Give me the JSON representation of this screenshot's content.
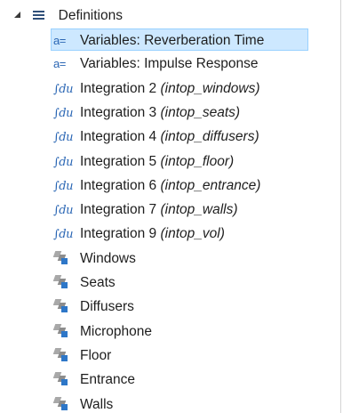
{
  "tree": {
    "root": {
      "label": "Definitions",
      "icon": "definitions-icon"
    },
    "items": [
      {
        "type": "variables",
        "icon": "variables-icon",
        "icon_text": "a=",
        "label": "Variables: Reverberation Time",
        "tag": "",
        "selected": true
      },
      {
        "type": "variables",
        "icon": "variables-icon",
        "icon_text": "a=",
        "label": "Variables: Impulse Response",
        "tag": "",
        "selected": false
      },
      {
        "type": "integration",
        "icon": "integration-icon",
        "icon_text": "∫du",
        "label": "Integration 2 ",
        "tag": "(intop_windows)",
        "selected": false
      },
      {
        "type": "integration",
        "icon": "integration-icon",
        "icon_text": "∫du",
        "label": "Integration 3 ",
        "tag": "(intop_seats)",
        "selected": false
      },
      {
        "type": "integration",
        "icon": "integration-icon",
        "icon_text": "∫du",
        "label": "Integration 4 ",
        "tag": "(intop_diffusers)",
        "selected": false
      },
      {
        "type": "integration",
        "icon": "integration-icon",
        "icon_text": "∫du",
        "label": "Integration 5 ",
        "tag": "(intop_floor)",
        "selected": false
      },
      {
        "type": "integration",
        "icon": "integration-icon",
        "icon_text": "∫du",
        "label": "Integration 6 ",
        "tag": "(intop_entrance)",
        "selected": false
      },
      {
        "type": "integration",
        "icon": "integration-icon",
        "icon_text": "∫du",
        "label": "Integration 7 ",
        "tag": "(intop_walls)",
        "selected": false
      },
      {
        "type": "integration",
        "icon": "integration-icon",
        "icon_text": "∫du",
        "label": "Integration 9 ",
        "tag": "(intop_vol)",
        "selected": false
      },
      {
        "type": "selection",
        "icon": "selection-icon",
        "icon_text": "",
        "label": "Windows",
        "tag": "",
        "selected": false
      },
      {
        "type": "selection",
        "icon": "selection-icon",
        "icon_text": "",
        "label": "Seats",
        "tag": "",
        "selected": false
      },
      {
        "type": "selection",
        "icon": "selection-icon",
        "icon_text": "",
        "label": "Diffusers",
        "tag": "",
        "selected": false
      },
      {
        "type": "selection",
        "icon": "selection-icon",
        "icon_text": "",
        "label": "Microphone",
        "tag": "",
        "selected": false
      },
      {
        "type": "selection",
        "icon": "selection-icon",
        "icon_text": "",
        "label": "Floor",
        "tag": "",
        "selected": false
      },
      {
        "type": "selection",
        "icon": "selection-icon",
        "icon_text": "",
        "label": "Entrance",
        "tag": "",
        "selected": false
      },
      {
        "type": "selection",
        "icon": "selection-icon",
        "icon_text": "",
        "label": "Walls",
        "tag": "",
        "selected": false
      }
    ]
  },
  "colors": {
    "selection_bg": "#cde8ff",
    "selection_border": "#99d1ff",
    "icon_blue": "#2a66b4"
  }
}
